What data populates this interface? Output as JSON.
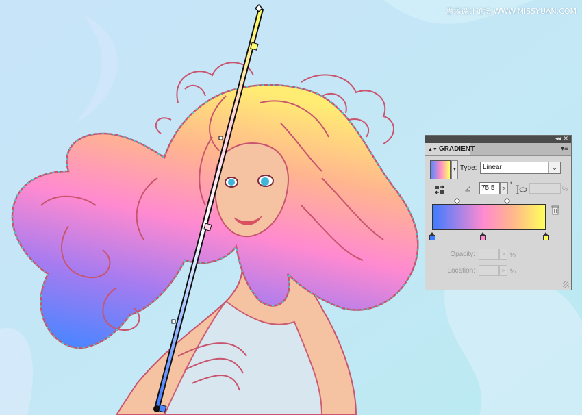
{
  "watermark": "思缘设计论坛 WWW.MISSYUAN.COM",
  "panel": {
    "title": "GRADIENT",
    "type_label": "Type:",
    "type_value": "Linear",
    "angle_value": "75.5",
    "degree_symbol": "°",
    "aspect_percent": "%",
    "opacity_label": "Opacity:",
    "opacity_percent": "%",
    "location_label": "Location:",
    "location_percent": "%",
    "icons": {
      "collapse": "double-chevron-icon",
      "close": "close-icon",
      "menu": "panel-menu-icon",
      "reverse": "reverse-gradient-icon",
      "angle": "angle-icon",
      "aspect": "aspect-ratio-icon",
      "delete": "trash-icon"
    },
    "stops": [
      {
        "color": "#3f7bff",
        "location": 0
      },
      {
        "color": "#ff8ad0",
        "location": 45
      },
      {
        "color": "#ffff5c",
        "location": 100
      }
    ],
    "midpoints": [
      22,
      66
    ]
  },
  "colors": {
    "background": "#c6e6f7",
    "hair_outline": "#c8546e",
    "skin": "#f6c3a2",
    "selection": "#37d6e0",
    "gradient_start": "#4f8bff",
    "gradient_mid": "#ff8ac8",
    "gradient_end": "#ffff6a"
  }
}
